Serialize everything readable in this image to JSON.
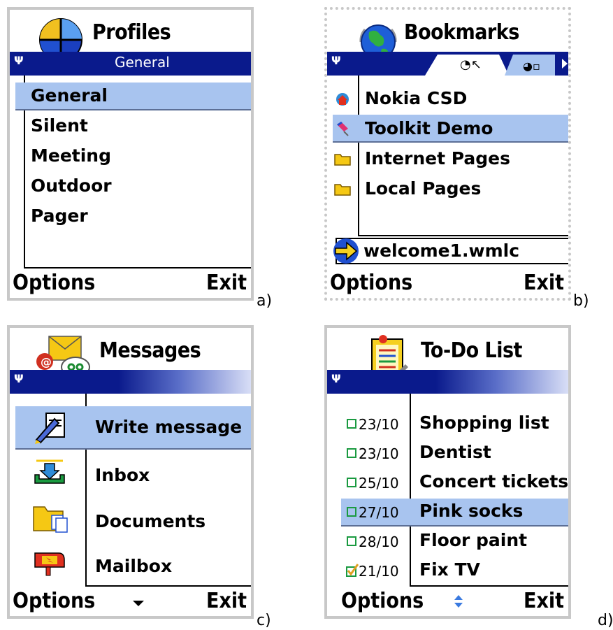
{
  "panels": {
    "a": {
      "title": "Profiles",
      "status_label": "General",
      "items": [
        "General",
        "Silent",
        "Meeting",
        "Outdoor",
        "Pager"
      ],
      "selected_index": 0,
      "left_softkey": "Options",
      "right_softkey": "Exit",
      "caption": "a)",
      "icon": "profiles-globe-icon"
    },
    "b": {
      "title": "Bookmarks",
      "items": [
        {
          "label": "Nokia CSD",
          "icon": "home-bookmark-icon"
        },
        {
          "label": "Toolkit Demo",
          "icon": "pin-bookmark-icon"
        },
        {
          "label": "Internet Pages",
          "icon": "folder-icon"
        },
        {
          "label": "Local Pages",
          "icon": "folder-icon"
        }
      ],
      "selected_index": 1,
      "address": "welcome1.wmlc",
      "left_softkey": "Options",
      "right_softkey": "Exit",
      "caption": "b)",
      "icon": "globe-icon"
    },
    "c": {
      "title": "Messages",
      "items": [
        {
          "label": "Write message",
          "icon": "write-message-icon"
        },
        {
          "label": "Inbox",
          "icon": "inbox-icon"
        },
        {
          "label": "Documents",
          "icon": "documents-folder-icon"
        },
        {
          "label": "Mailbox",
          "icon": "mailbox-icon"
        }
      ],
      "selected_index": 0,
      "left_softkey": "Options",
      "right_softkey": "Exit",
      "caption": "c)",
      "icon": "messages-icon"
    },
    "d": {
      "title": "To-Do List",
      "items": [
        {
          "date": "23/10",
          "label": "Shopping list",
          "done": false
        },
        {
          "date": "23/10",
          "label": "Dentist",
          "done": false
        },
        {
          "date": "25/10",
          "label": "Concert tickets",
          "done": false
        },
        {
          "date": "27/10",
          "label": "Pink socks",
          "done": false
        },
        {
          "date": "28/10",
          "label": "Floor paint",
          "done": false
        },
        {
          "date": "21/10",
          "label": "Fix TV",
          "done": true
        }
      ],
      "selected_index": 3,
      "left_softkey": "Options",
      "right_softkey": "Exit",
      "caption": "d)",
      "icon": "todo-list-icon"
    }
  },
  "colors": {
    "highlight": "#a8c4ef",
    "status_bar": "#0a1a8c",
    "frame": "#c8c8c8"
  }
}
